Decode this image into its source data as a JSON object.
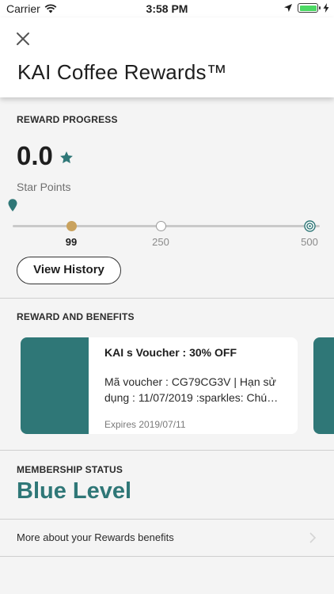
{
  "status_bar": {
    "carrier": "Carrier",
    "time": "3:58 PM"
  },
  "header": {
    "title": "KAI Coffee Rewards™"
  },
  "reward_progress": {
    "section_label": "REWARD PROGRESS",
    "points_value": "0.0",
    "points_label": "Star Points",
    "milestones": [
      {
        "label": "99",
        "reached": true
      },
      {
        "label": "250",
        "reached": false
      },
      {
        "label": "500",
        "reached": false
      }
    ],
    "view_history_label": "View History"
  },
  "rewards": {
    "section_label": "REWARD AND BENEFITS",
    "cards": [
      {
        "title": "KAI s Voucher : 30% OFF",
        "description": "Mã voucher : CG79CG3V | Hạn sử dụng : 11/07/2019 :sparkles: Chú…",
        "expires": "Expires  2019/07/11"
      }
    ]
  },
  "membership": {
    "section_label": "MEMBERSHIP STATUS",
    "level": "Blue Level",
    "more_link": "More about your Rewards benefits"
  },
  "colors": {
    "accent": "#2f7777",
    "gold": "#c9a25e",
    "battery": "#4cd964",
    "background": "#f4f4f4"
  },
  "icons": [
    "wifi-icon",
    "location-arrow-icon",
    "battery-icon",
    "charging-bolt-icon",
    "close-icon",
    "star-icon",
    "map-pin-icon",
    "target-icon",
    "chevron-right-icon"
  ]
}
